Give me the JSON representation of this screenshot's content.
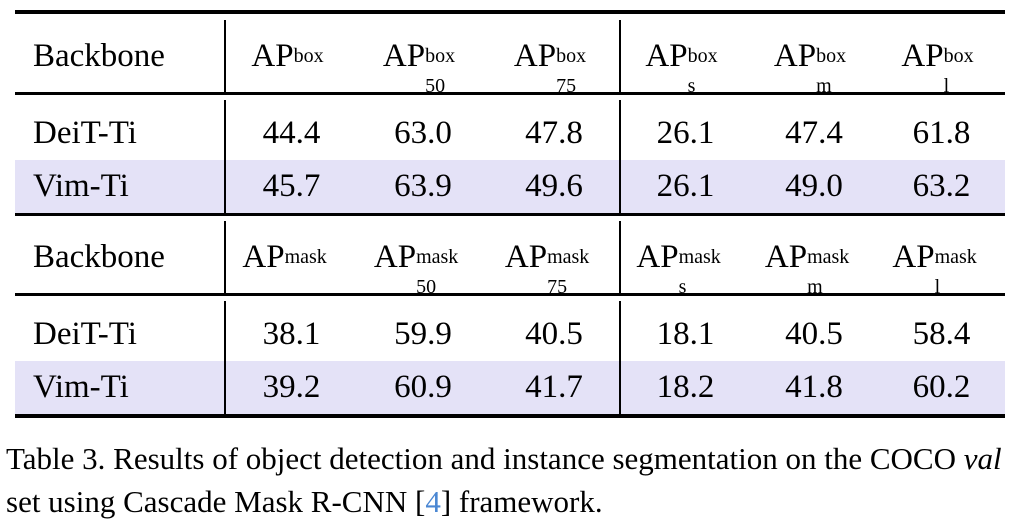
{
  "table": {
    "sections": [
      {
        "id": "box",
        "headers": [
          {
            "label": "Backbone",
            "base": "",
            "sup": "",
            "sub": ""
          },
          {
            "label": "AP^box",
            "base": "AP",
            "sup": "box",
            "sub": ""
          },
          {
            "label": "AP^box_50",
            "base": "AP",
            "sup": "box",
            "sub": "50"
          },
          {
            "label": "AP^box_75",
            "base": "AP",
            "sup": "box",
            "sub": "75"
          },
          {
            "label": "AP^box_s",
            "base": "AP",
            "sup": "box",
            "sub": "s"
          },
          {
            "label": "AP^box_m",
            "base": "AP",
            "sup": "box",
            "sub": "m"
          },
          {
            "label": "AP^box_l",
            "base": "AP",
            "sup": "box",
            "sub": "l"
          }
        ],
        "rows": [
          {
            "backbone": "DeiT-Ti",
            "values": [
              "44.4",
              "63.0",
              "47.8",
              "26.1",
              "47.4",
              "61.8"
            ],
            "highlight": false
          },
          {
            "backbone": "Vim-Ti",
            "values": [
              "45.7",
              "63.9",
              "49.6",
              "26.1",
              "49.0",
              "63.2"
            ],
            "highlight": true
          }
        ]
      },
      {
        "id": "mask",
        "headers": [
          {
            "label": "Backbone",
            "base": "",
            "sup": "",
            "sub": ""
          },
          {
            "label": "AP^mask",
            "base": "AP",
            "sup": "mask",
            "sub": ""
          },
          {
            "label": "AP^mask_50",
            "base": "AP",
            "sup": "mask",
            "sub": "50"
          },
          {
            "label": "AP^mask_75",
            "base": "AP",
            "sup": "mask",
            "sub": "75"
          },
          {
            "label": "AP^mask_s",
            "base": "AP",
            "sup": "mask",
            "sub": "s"
          },
          {
            "label": "AP^mask_m",
            "base": "AP",
            "sup": "mask",
            "sub": "m"
          },
          {
            "label": "AP^mask_l",
            "base": "AP",
            "sup": "mask",
            "sub": "l"
          }
        ],
        "rows": [
          {
            "backbone": "DeiT-Ti",
            "values": [
              "38.1",
              "59.9",
              "40.5",
              "18.1",
              "40.5",
              "58.4"
            ],
            "highlight": false
          },
          {
            "backbone": "Vim-Ti",
            "values": [
              "39.2",
              "60.9",
              "41.7",
              "18.2",
              "41.8",
              "60.2"
            ],
            "highlight": true
          }
        ]
      }
    ],
    "highlight_color": "#e4e2f7",
    "rule_color": "#000000"
  },
  "caption": {
    "label": "Table 3.",
    "text_part1": "Results of object detection and instance segmentation on the COCO ",
    "italic_word": "val",
    "text_part2": " set using Cascade Mask R-CNN ",
    "citation_open": "[",
    "citation_number": "4",
    "citation_close": "]",
    "text_part3": " framework.",
    "citation_color": "#4a87d3"
  }
}
